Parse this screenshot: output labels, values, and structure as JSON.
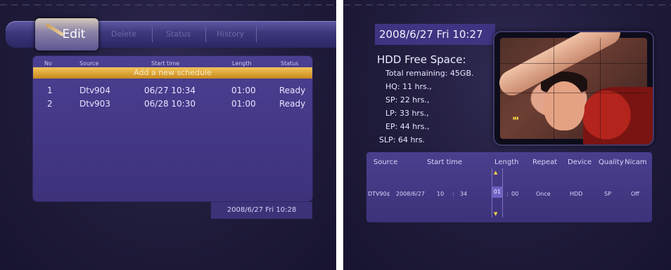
{
  "left": {
    "tabs": {
      "edit": "Edit",
      "delete": "Delete",
      "status": "Status",
      "history": "History"
    },
    "table": {
      "headers": [
        "No",
        "Source",
        "Start time",
        "Length",
        "Status"
      ],
      "add_row": "Add a new schedule",
      "rows": [
        {
          "no": "1",
          "source": "Dtv904",
          "start": "06/27 10:34",
          "length": "01:00",
          "status": "Ready"
        },
        {
          "no": "2",
          "source": "Dtv903",
          "start": "06/28 10:30",
          "length": "01:00",
          "status": "Ready"
        }
      ]
    },
    "timestamp": "2008/6/27 Fri 10:28"
  },
  "right": {
    "datetime": "2008/6/27 Fri 10:27",
    "free_space": {
      "title": "HDD Free Space:",
      "total": "Total remaining: 45GB.",
      "hq": "HQ: 11 hrs.,",
      "sp": "SP: 22 hrs.,",
      "lp": "LP: 33 hrs.,",
      "ep": "EP: 44 hrs.,",
      "slp": "SLP: 64 hrs."
    },
    "record": {
      "headers": {
        "source": "Source",
        "start_time": "Start time",
        "length": "Length",
        "repeat": "Repeat",
        "device": "Device",
        "quality": "Quality",
        "nicam": "Nicam"
      },
      "values": {
        "source": "DTV90¢",
        "date": "2008/6/27",
        "hour": "10",
        "colon1": ":",
        "minute": "34",
        "len_hours": "01",
        "colon2": ":",
        "len_minutes": "00",
        "repeat": "Once",
        "device": "HDD",
        "quality": "SP",
        "nicam": "Off"
      }
    }
  },
  "colors": {
    "background": "#1f1b3a",
    "panel": "#4b3f91",
    "highlight": "#e8b13e"
  }
}
